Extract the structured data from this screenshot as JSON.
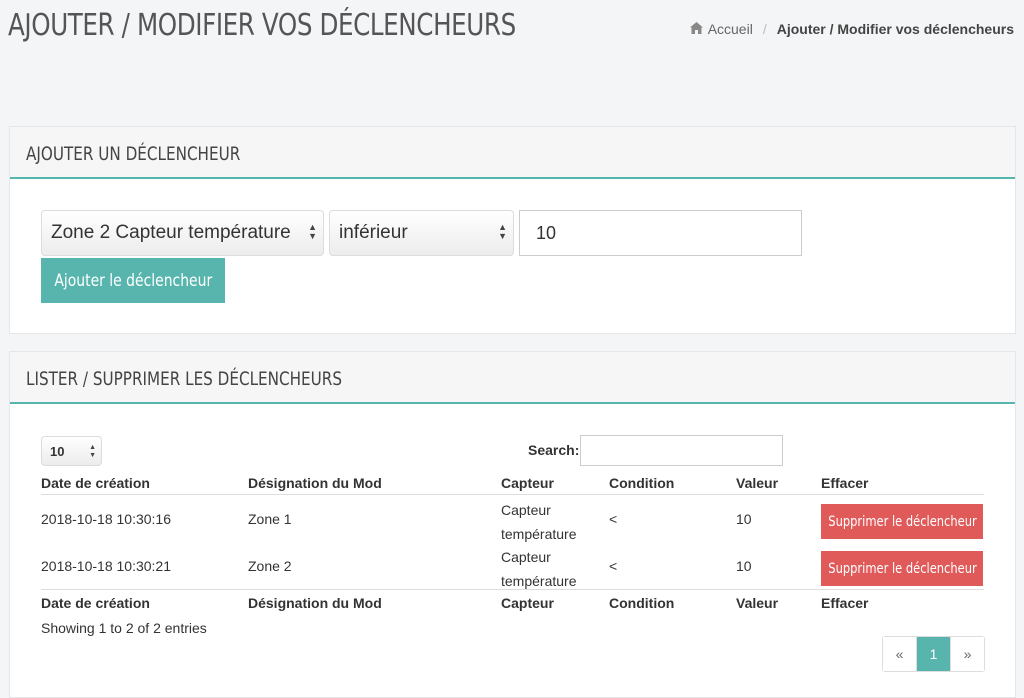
{
  "page": {
    "title": "AJOUTER / MODIFIER VOS DÉCLENCHEURS"
  },
  "breadcrumb": {
    "icon": "home-icon",
    "home": "Accueil",
    "separator": "/",
    "current": "Ajouter / Modifier vos déclencheurs"
  },
  "add_panel": {
    "title": "AJOUTER UN DÉCLENCHEUR",
    "sensor_select": "Zone 2 Capteur température",
    "condition_select": "inférieur",
    "value_input": "10",
    "add_button": "Ajouter le déclencheur"
  },
  "list_panel": {
    "title": "LISTER / SUPPRIMER LES DÉCLENCHEURS",
    "page_length": "10",
    "search_label": "Search:",
    "search_value": "",
    "columns": [
      "Date de création",
      "Désignation du Mod",
      "Capteur",
      "Condition",
      "Valeur",
      "Effacer"
    ],
    "rows": [
      {
        "date": "2018-10-18 10:30:16",
        "module": "Zone 1",
        "sensor_line1": "Capteur",
        "sensor_line2": "température",
        "condition": "<",
        "value": "10",
        "delete": "Supprimer le déclencheur"
      },
      {
        "date": "2018-10-18 10:30:21",
        "module": "Zone 2",
        "sensor_line1": "Capteur",
        "sensor_line2": "température",
        "condition": "<",
        "value": "10",
        "delete": "Supprimer le déclencheur"
      }
    ],
    "info": "Showing 1 to 2 of 2 entries",
    "pagination": {
      "prev": "«",
      "current": "1",
      "next": "»"
    }
  },
  "colors": {
    "accent": "#58b5ad",
    "danger": "#e05a5a",
    "background": "#f4f5f7"
  }
}
